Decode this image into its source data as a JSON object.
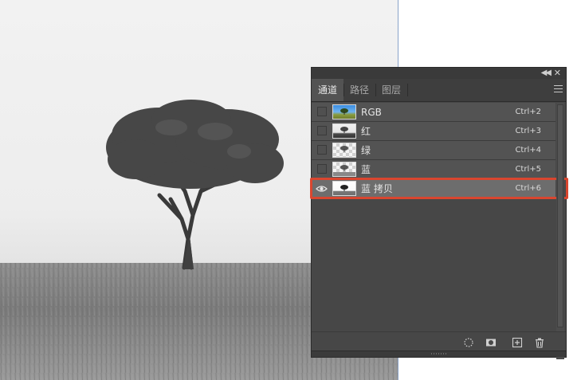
{
  "panel": {
    "tabs": [
      {
        "label": "通道",
        "active": true
      },
      {
        "label": "路径",
        "active": false
      },
      {
        "label": "图层",
        "active": false
      }
    ],
    "channels": [
      {
        "name": "RGB",
        "shortcut": "Ctrl+2",
        "visible": false,
        "selected": false
      },
      {
        "name": "红",
        "shortcut": "Ctrl+3",
        "visible": false,
        "selected": false
      },
      {
        "name": "绿",
        "shortcut": "Ctrl+4",
        "visible": false,
        "selected": false
      },
      {
        "name": "蓝",
        "shortcut": "Ctrl+5",
        "visible": false,
        "selected": false
      },
      {
        "name": "蓝 拷贝",
        "shortcut": "Ctrl+6",
        "visible": true,
        "selected": true
      }
    ],
    "footer_icons": [
      "load-selection-icon",
      "save-selection-icon",
      "new-channel-icon",
      "delete-icon"
    ],
    "highlight_color": "#d9462f"
  }
}
